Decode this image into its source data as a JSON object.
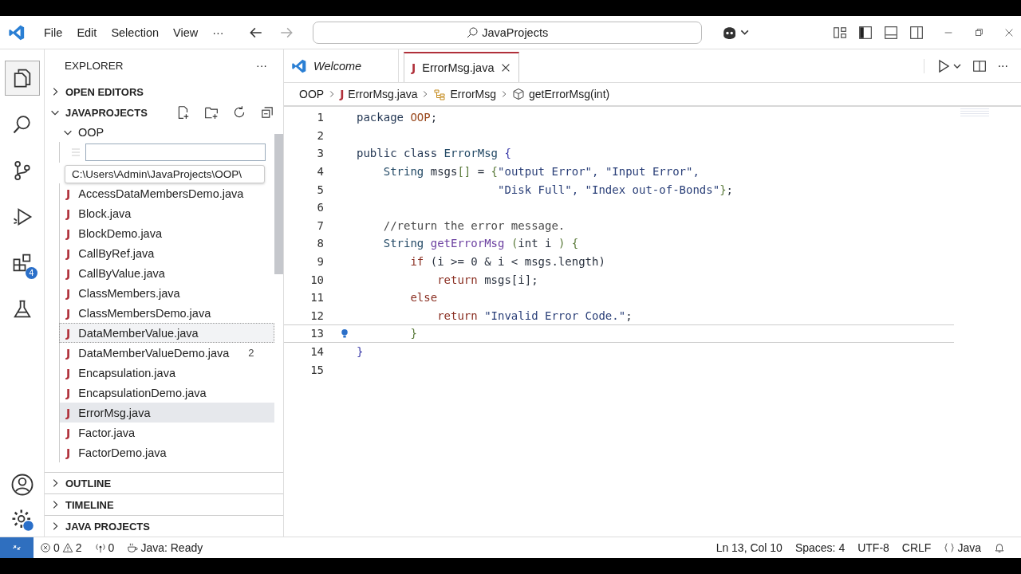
{
  "menu": [
    "File",
    "Edit",
    "Selection",
    "View",
    "···"
  ],
  "command_center": {
    "value": "JavaProjects"
  },
  "activity_bar": [
    {
      "selected": true
    },
    {
      "selected": false
    },
    {
      "selected": false
    },
    {
      "selected": false
    },
    {
      "selected": false,
      "badge": "4"
    },
    {
      "selected": false
    }
  ],
  "sidebar": {
    "title": "EXPLORER",
    "more": "···",
    "open_editors": {
      "label": "OPEN EDITORS",
      "expanded": false
    },
    "project": {
      "label": "JAVAPROJECTS",
      "expanded": true,
      "folders": [
        {
          "name": "OOP",
          "expanded": true,
          "new_file_input": {
            "tooltip": "C:\\Users\\Admin\\JavaProjects\\OOP\\"
          },
          "children": [
            {
              "icon": "J",
              "name": "AccessDataMembersDemo.java",
              "selected": false,
              "focused": false
            },
            {
              "icon": "J",
              "name": "Block.java",
              "selected": false,
              "focused": false
            },
            {
              "icon": "J",
              "name": "BlockDemo.java",
              "selected": false,
              "focused": false
            },
            {
              "icon": "J",
              "name": "CallByRef.java",
              "selected": false,
              "focused": false
            },
            {
              "icon": "J",
              "name": "CallByValue.java",
              "selected": false,
              "focused": false
            },
            {
              "icon": "J",
              "name": "ClassMembers.java",
              "selected": false,
              "focused": false
            },
            {
              "icon": "J",
              "name": "ClassMembersDemo.java",
              "selected": false,
              "focused": false
            },
            {
              "icon": "J",
              "name": "DataMemberValue.java",
              "selected": false,
              "focused": true
            },
            {
              "icon": "J",
              "name": "DataMemberValueDemo.java",
              "selected": false,
              "focused": false,
              "badge": "2"
            },
            {
              "icon": "J",
              "name": "Encapsulation.java",
              "selected": false,
              "focused": false
            },
            {
              "icon": "J",
              "name": "EncapsulationDemo.java",
              "selected": false,
              "focused": false
            },
            {
              "icon": "J",
              "name": "ErrorMsg.java",
              "selected": true,
              "focused": false
            },
            {
              "icon": "J",
              "name": "Factor.java",
              "selected": false,
              "focused": false
            },
            {
              "icon": "J",
              "name": "FactorDemo.java",
              "selected": false,
              "focused": false
            }
          ]
        }
      ]
    },
    "sections": [
      {
        "label": "OUTLINE",
        "expanded": false
      },
      {
        "label": "TIMELINE",
        "expanded": false
      },
      {
        "label": "JAVA PROJECTS",
        "expanded": false
      }
    ]
  },
  "tabs": [
    {
      "label": "Welcome",
      "kind": "welcome",
      "selected": false
    },
    {
      "icon": "J",
      "label": "ErrorMsg.java",
      "kind": "java",
      "selected": true
    }
  ],
  "breadcrumb": [
    {
      "label": "OOP",
      "kind": "folder"
    },
    {
      "icon": "J",
      "label": "ErrorMsg.java",
      "kind": "java"
    },
    {
      "label": "ErrorMsg",
      "kind": "class"
    },
    {
      "label": "getErrorMsg(int)",
      "kind": "method"
    }
  ],
  "code": [
    {
      "number": "1",
      "current": false,
      "tokens": [
        {
          "t": "package ",
          "kind": "kw"
        },
        {
          "t": "OOP",
          "kind": "ns"
        },
        {
          "t": ";",
          "kind": "p"
        }
      ]
    },
    {
      "number": "2",
      "current": false
    },
    {
      "number": "3",
      "current": false,
      "tokens": [
        {
          "t": "public class ",
          "kind": "kw"
        },
        {
          "t": "ErrorMsg ",
          "kind": "type"
        },
        {
          "t": "{",
          "kind": "brace"
        }
      ]
    },
    {
      "number": "4",
      "current": false,
      "tokens": [
        {
          "t": "    String ",
          "kind": "type"
        },
        {
          "t": "msgs",
          "kind": "p"
        },
        {
          "t": "[]",
          "kind": "brace2"
        },
        {
          "t": " = ",
          "kind": "p"
        },
        {
          "t": "{",
          "kind": "brace2"
        },
        {
          "t": "\"output Error\", \"Input Error\",",
          "kind": "str"
        }
      ]
    },
    {
      "number": "5",
      "current": false,
      "tokens": [
        {
          "t": "                     \"Disk Full\", \"Index out-of-Bonds\"",
          "kind": "str"
        },
        {
          "t": "}",
          "kind": "brace2"
        },
        {
          "t": ";",
          "kind": "p"
        }
      ]
    },
    {
      "number": "6",
      "current": false
    },
    {
      "number": "7",
      "current": false,
      "tokens": [
        {
          "t": "    //return the error message.",
          "kind": "comment"
        }
      ]
    },
    {
      "number": "8",
      "current": false,
      "tokens": [
        {
          "t": "    String ",
          "kind": "type"
        },
        {
          "t": "getErrorMsg ",
          "kind": "fn"
        },
        {
          "t": "(",
          "kind": "brace2"
        },
        {
          "t": "int i ",
          "kind": "p"
        },
        {
          "t": ") {",
          "kind": "brace2"
        }
      ]
    },
    {
      "number": "9",
      "current": false,
      "tokens": [
        {
          "t": "        if ",
          "kind": "ctrl"
        },
        {
          "t": "(i >= 0 & i < msgs.length)",
          "kind": "p"
        }
      ]
    },
    {
      "number": "10",
      "current": false,
      "tokens": [
        {
          "t": "            return ",
          "kind": "ctrl"
        },
        {
          "t": "msgs[i];",
          "kind": "p"
        }
      ]
    },
    {
      "number": "11",
      "current": false,
      "tokens": [
        {
          "t": "        else",
          "kind": "ctrl"
        }
      ]
    },
    {
      "number": "12",
      "current": false,
      "tokens": [
        {
          "t": "            return ",
          "kind": "ctrl"
        },
        {
          "t": "\"Invalid Error Code.\"",
          "kind": "str"
        },
        {
          "t": ";",
          "kind": "p"
        }
      ]
    },
    {
      "number": "13",
      "current": true,
      "lightbulb": true,
      "tokens": [
        {
          "t": "        }",
          "kind": "brace2"
        }
      ]
    },
    {
      "number": "14",
      "current": false,
      "tokens": [
        {
          "t": "}",
          "kind": "brace"
        }
      ]
    },
    {
      "number": "15",
      "current": false
    }
  ],
  "status_bar": {
    "errors": "0",
    "warnings": "2",
    "ports": "0",
    "java": "Java: Ready",
    "right": [
      "Ln 13, Col 10",
      "Spaces: 4",
      "UTF-8",
      "CRLF"
    ],
    "language": "Java"
  }
}
